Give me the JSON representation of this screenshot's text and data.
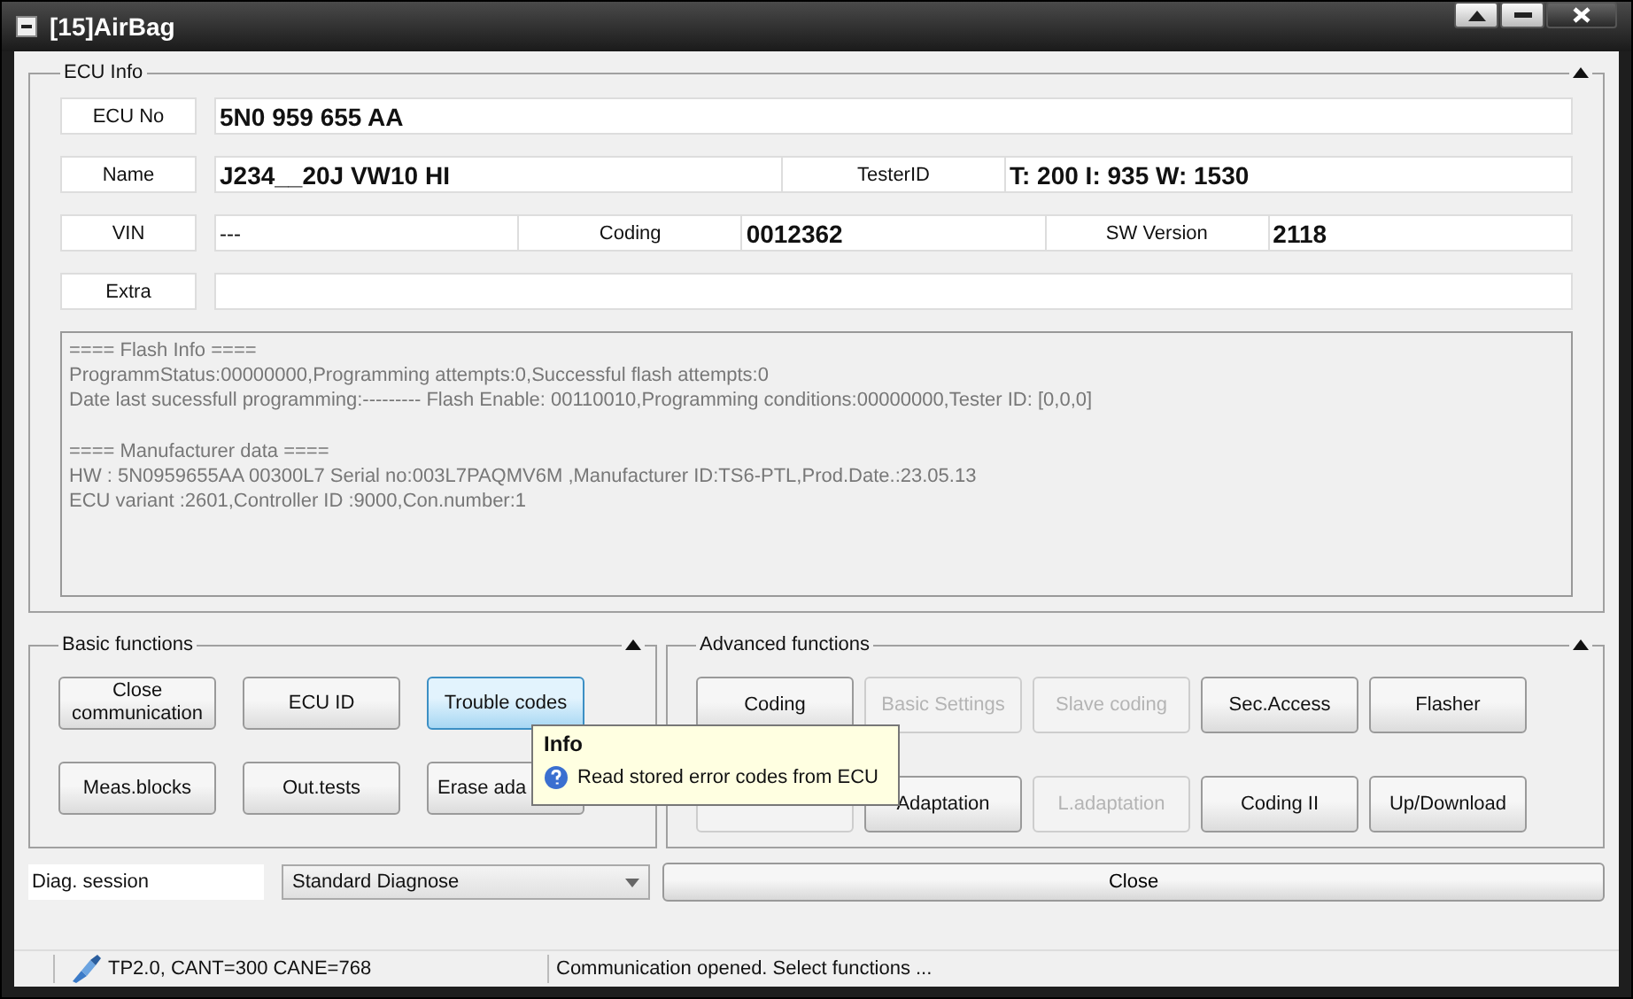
{
  "window": {
    "title": "[15]AirBag"
  },
  "ecu_info": {
    "title": "ECU Info",
    "rows": [
      {
        "fields": [
          {
            "label": "ECU No",
            "value": "5N0 959 655 AA"
          }
        ]
      },
      {
        "fields": [
          {
            "label": "Name",
            "value": "J234__20J VW10 HI"
          },
          {
            "label": "TesterID",
            "value": "T: 200 I: 935 W: 1530"
          }
        ]
      },
      {
        "fields": [
          {
            "label": "VIN",
            "value": "---",
            "plain": true
          },
          {
            "label": "Coding",
            "value": "0012362"
          },
          {
            "label": "SW Version",
            "value": "2118"
          }
        ]
      },
      {
        "fields": [
          {
            "label": "Extra"
          }
        ]
      }
    ],
    "log": [
      [
        "==== Flash Info ====",
        "ProgrammStatus:00000000,Programming attempts:0,Successful flash attempts:0",
        "Date last sucessfull programming:--------- Flash Enable: 00110010,Programming conditions:00000000,Tester ID: [0,0,0]"
      ],
      [
        "==== Manufacturer data ====",
        "HW : 5N0959655AA  00300L7 Serial no:003L7PAQMV6M  ,Manufacturer ID:TS6-PTL,Prod.Date.:23.05.13",
        "ECU variant :2601,Controller ID :9000,Con.number:1"
      ]
    ]
  },
  "basic_functions": {
    "title": "Basic functions",
    "buttons": [
      {
        "label": "Close communication",
        "selected": false,
        "covered": false
      },
      {
        "label": "ECU ID",
        "selected": false,
        "covered": false
      },
      {
        "label": "Trouble codes",
        "selected": true,
        "covered": false
      },
      {
        "label": "Meas.blocks",
        "selected": false,
        "covered": false
      },
      {
        "label": "Out.tests",
        "selected": false,
        "covered": false
      },
      {
        "label": "Erase ada",
        "selected": false,
        "covered": true
      }
    ]
  },
  "advanced_functions": {
    "title": "Advanced functions",
    "buttons": [
      {
        "label": "Coding",
        "disabled": false
      },
      {
        "label": "Basic Settings",
        "disabled": true
      },
      {
        "label": "Slave coding",
        "disabled": true
      },
      {
        "label": "Sec.Access",
        "disabled": false
      },
      {
        "label": "Flasher",
        "disabled": false
      },
      {
        "disabled": true
      },
      {
        "label": "Adaptation",
        "disabled": false
      },
      {
        "label": "L.adaptation",
        "disabled": true
      },
      {
        "label": "Coding II",
        "disabled": false
      },
      {
        "label": "Up/Download",
        "disabled": false
      }
    ]
  },
  "diag_session": {
    "label": "Diag. session",
    "value": "Standard Diagnose"
  },
  "close_button": "Close",
  "tooltip": {
    "title": "Info",
    "text": "Read stored error codes from ECU"
  },
  "status_bar": {
    "connection": "TP2.0, CANT=300 CANE=768",
    "message": "Communication opened. Select functions ..."
  }
}
